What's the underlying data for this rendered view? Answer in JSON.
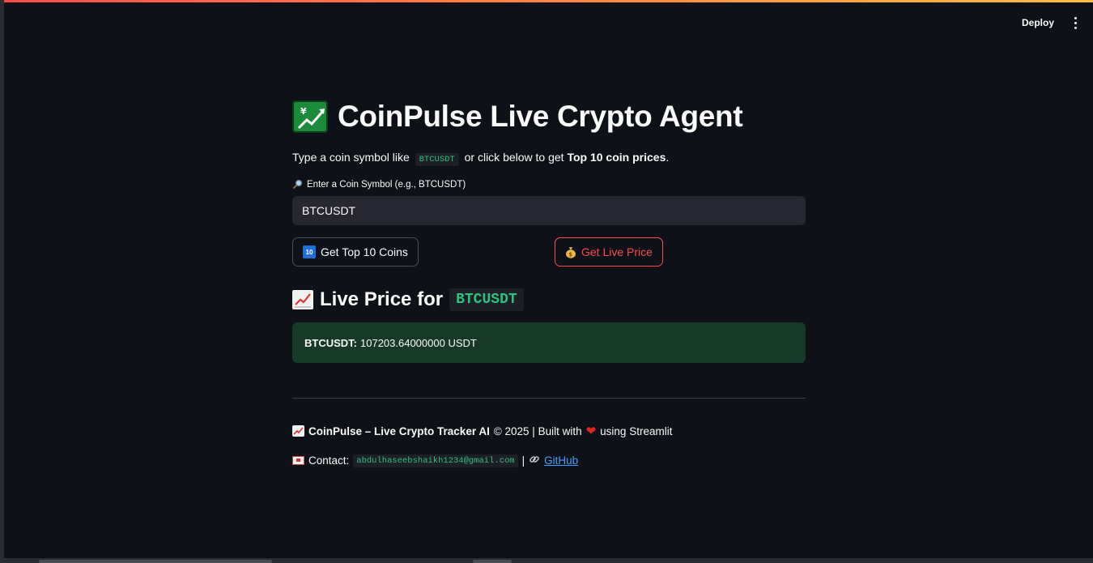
{
  "app": {
    "deploy_label": "Deploy",
    "colors": {
      "accent": "#ff4b4b",
      "background": "#0e1117",
      "success_bg": "#173928",
      "code_green": "#2ec27e",
      "link": "#4aa0ff"
    }
  },
  "header": {
    "title_icon": "chart-increasing-with-yen-icon",
    "title": "CoinPulse Live Crypto Agent"
  },
  "intro": {
    "prefix": "Type a coin symbol like",
    "code": "BTCUSDT",
    "middle": "or click below to get",
    "bold": "Top 10 coin prices",
    "suffix": "."
  },
  "search": {
    "label": "Enter a Coin Symbol (e.g., BTCUSDT)",
    "label_icon": "magnifying-glass-icon",
    "value": "BTCUSDT"
  },
  "buttons": {
    "top10_icon": "keycap-10-icon",
    "top10_badge": "10",
    "top10_label": "Get Top 10 Coins",
    "live_icon": "money-bag-icon",
    "live_label": "Get Live Price"
  },
  "result": {
    "heading_icon": "chart-increasing-icon",
    "heading": "Live Price for",
    "symbol": "BTCUSDT",
    "price_symbol": "BTCUSDT:",
    "price_value": "107203.64000000 USDT"
  },
  "footer": {
    "line1_icon": "chart-increasing-icon",
    "brand": "CoinPulse – Live Crypto Tracker AI",
    "copyright": "© 2025 | Built with",
    "heart": "❤",
    "using": "using Streamlit",
    "contact_icon": "envelope-icon",
    "contact_label": "Contact:",
    "email": "abdulhaseebshaikh1234@gmail.com",
    "separator": "|",
    "link_icon": "link-icon",
    "github_label": "GitHub"
  }
}
